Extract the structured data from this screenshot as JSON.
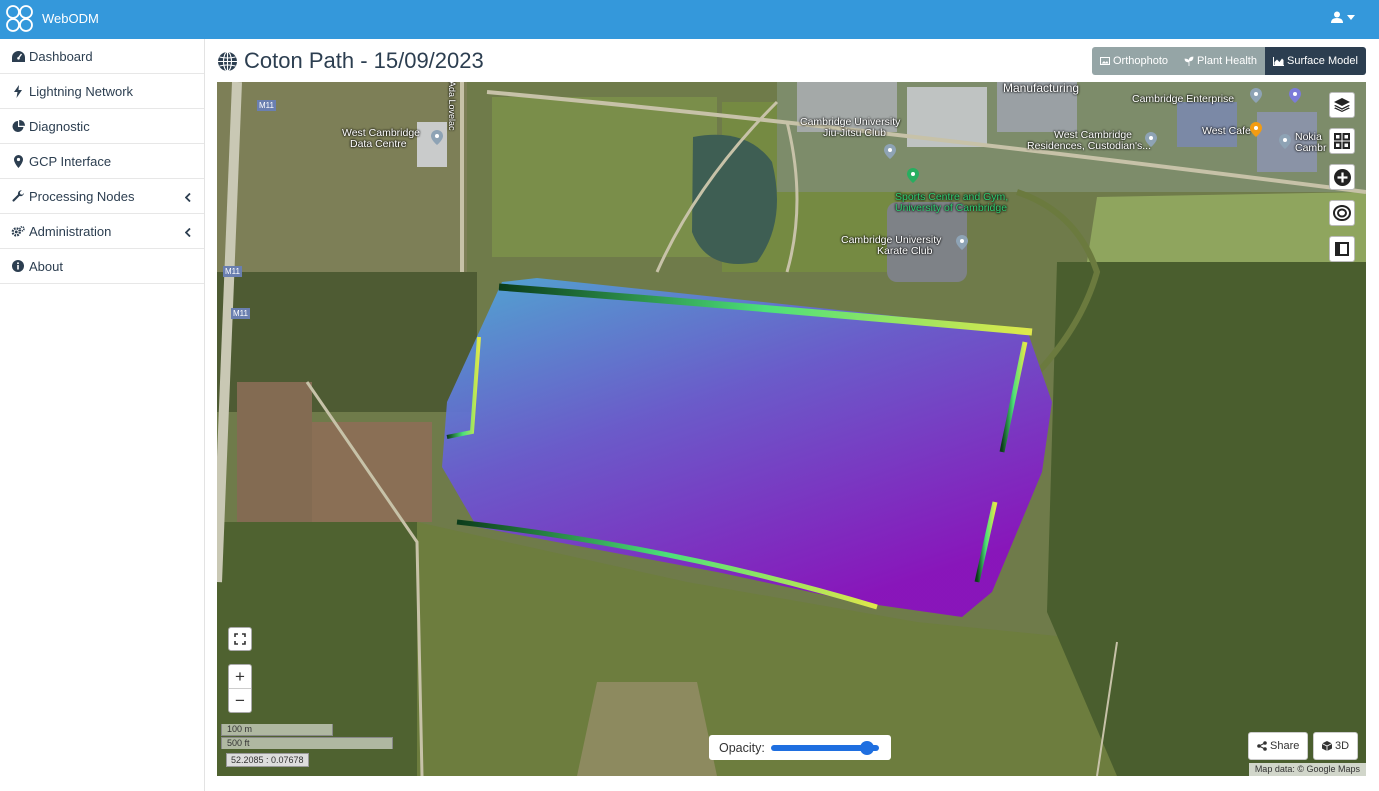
{
  "app": {
    "brand": "WebODM"
  },
  "sidebar": {
    "items": [
      {
        "label": "Dashboard",
        "icon": "dashboard-icon"
      },
      {
        "label": "Lightning Network",
        "icon": "bolt-icon"
      },
      {
        "label": "Diagnostic",
        "icon": "pie-chart-icon"
      },
      {
        "label": "GCP Interface",
        "icon": "map-marker-icon"
      },
      {
        "label": "Processing Nodes",
        "icon": "wrench-icon",
        "expandable": true
      },
      {
        "label": "Administration",
        "icon": "cogs-icon",
        "expandable": true
      },
      {
        "label": "About",
        "icon": "info-icon"
      }
    ]
  },
  "page": {
    "title": "Coton Path - 15/09/2023"
  },
  "view_tabs": {
    "orthophoto": "Orthophoto",
    "plant_health": "Plant Health",
    "surface_model": "Surface Model",
    "active": "surface_model"
  },
  "map": {
    "labels": {
      "manufacturing": "Manufacturing",
      "cambridge_enterprise": "Cambridge Enterprise",
      "west_cambridge_data_centre_1": "West Cambridge",
      "west_cambridge_data_centre_2": "Data Centre",
      "ada_lovelace": "Ada Lovelac",
      "jiujitsu_1": "Cambridge University",
      "jiujitsu_2": "Jiu-Jitsu Club",
      "residences_1": "West Cambridge",
      "residences_2": "Residences, Custodian's...",
      "west_cafe": "West Cafe",
      "nokia_1": "Nokia",
      "nokia_2": "Cambr",
      "sports_1": "Sports Centre and Gym,",
      "sports_2": "University of Cambridge",
      "karate_1": "Cambridge University",
      "karate_2": "Karate Club",
      "m11": "M11"
    },
    "scale_metric": "100 m",
    "scale_imperial": "500 ft",
    "coordinates": "52.2085 : 0.07678",
    "opacity_label": "Opacity:",
    "opacity_value": 0.95,
    "share_label": "Share",
    "three_d_label": "3D",
    "attribution": "Map data: © Google Maps",
    "zoom_in": "+",
    "zoom_out": "−"
  },
  "colors": {
    "topbar": "#3498db",
    "tab_active": "#2c3e50",
    "tab_inactive": "#95a5a6",
    "dsm_high": "#4fa8d8",
    "dsm_low": "#8a10c0"
  }
}
